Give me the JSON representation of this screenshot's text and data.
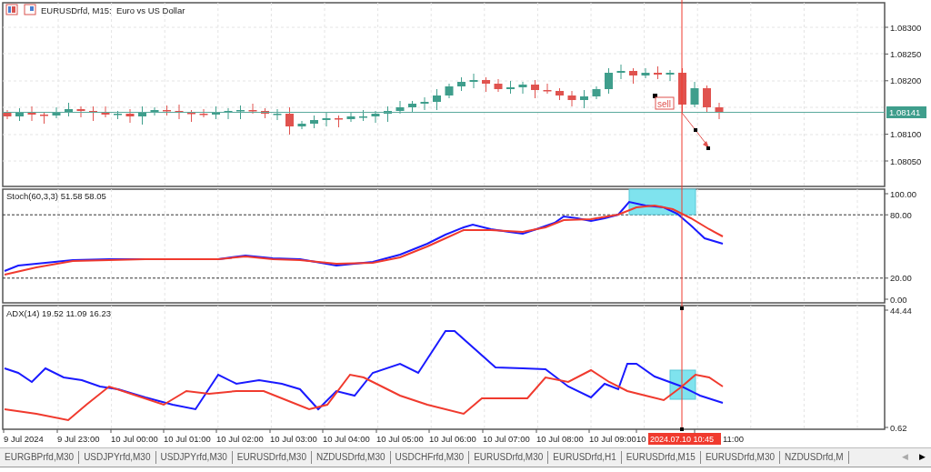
{
  "window": {
    "title": "EURUSDrfd, M15:  Euro vs US Dollar"
  },
  "main_panel": {
    "price_axis": [
      "1.08300",
      "1.08250",
      "1.08200",
      "1.08100",
      "1.08050"
    ],
    "current_price": "1.08141",
    "trade_label": "sell"
  },
  "stoch_panel": {
    "label": "Stoch(60,3,3) 51.58 58.05",
    "axis": [
      "100.00",
      "80.00",
      "20.00",
      "0.00"
    ]
  },
  "adx_panel": {
    "label": "ADX(14) 19.52 11.09 16.23",
    "axis": [
      "44.44",
      "0.62"
    ]
  },
  "time_axis": {
    "labels": [
      "9 Jul 2024",
      "9 Jul 23:00",
      "10 Jul 00:00",
      "10 Jul 01:00",
      "10 Jul 02:00",
      "10 Jul 03:00",
      "10 Jul 04:00",
      "10 Jul 05:00",
      "10 Jul 06:00",
      "10 Jul 07:00",
      "10 Jul 08:00",
      "10 Jul 09:00",
      "10",
      "11:00"
    ],
    "crosshair_time": "2024.07.10 10:45"
  },
  "tabs": [
    {
      "label": "EURGBPrfd,M30"
    },
    {
      "label": "USDJPYrfd,M30"
    },
    {
      "label": "USDJPYrfd,M30"
    },
    {
      "label": "EURUSDrfd,M30"
    },
    {
      "label": "NZDUSDrfd,M30"
    },
    {
      "label": "USDCHFrfd,M30"
    },
    {
      "label": "EURUSDrfd,M30"
    },
    {
      "label": "EURUSDrfd,H1"
    },
    {
      "label": "EURUSDrfd,M15"
    },
    {
      "label": "EURUSDrfd,M30"
    },
    {
      "label": "NZDUSDrfd,M"
    }
  ],
  "tab_scroll": {
    "left": "◀",
    "right": "▶",
    "left_disabled": true
  }
}
